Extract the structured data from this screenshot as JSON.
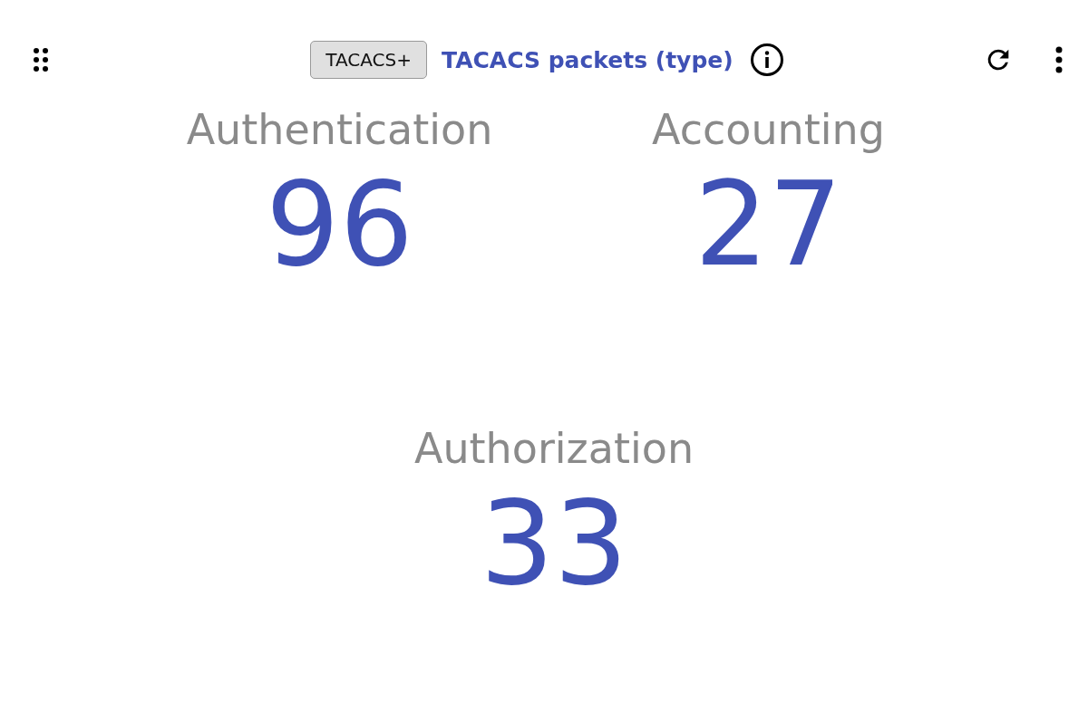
{
  "header": {
    "tag": "TACACS+",
    "title": "TACACS packets (type)"
  },
  "stats": [
    {
      "label": "Authentication",
      "value": "96"
    },
    {
      "label": "Accounting",
      "value": "27"
    },
    {
      "label": "Authorization",
      "value": "33"
    }
  ]
}
